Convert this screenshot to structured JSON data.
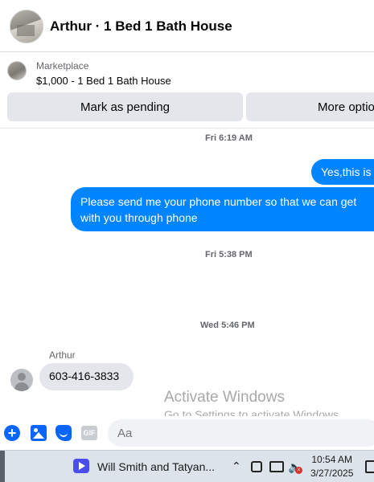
{
  "header": {
    "title": "Arthur · 1 Bed 1 Bath House"
  },
  "marketplace": {
    "label": "Marketplace",
    "listing": "$1,000 - 1 Bed 1 Bath House"
  },
  "actions": {
    "pending_label": "Mark as pending",
    "more_label": "More optio"
  },
  "messages": {
    "ts1": "Fri 6:19 AM",
    "out1": "Yes,this is",
    "out2_line1": "Please send me your phone  number so that we can get",
    "out2_line2": "with you through phone",
    "ts2": "Fri 5:38 PM",
    "ts3": "Wed 5:46 PM",
    "sender": "Arthur",
    "in1": "603-416-3833"
  },
  "watermark": {
    "line1": "Activate Windows",
    "line2": "Go to Settings to activate Windows."
  },
  "composer": {
    "placeholder": "Aa",
    "gif_label": "GIF"
  },
  "taskbar": {
    "app_title": "Will Smith and Tatyan...",
    "time": "10:54 AM",
    "date": "3/27/2025"
  },
  "colors": {
    "accent": "#0084ff",
    "bubble_in": "#e4e6eb",
    "icon_blue": "#0866ff"
  }
}
